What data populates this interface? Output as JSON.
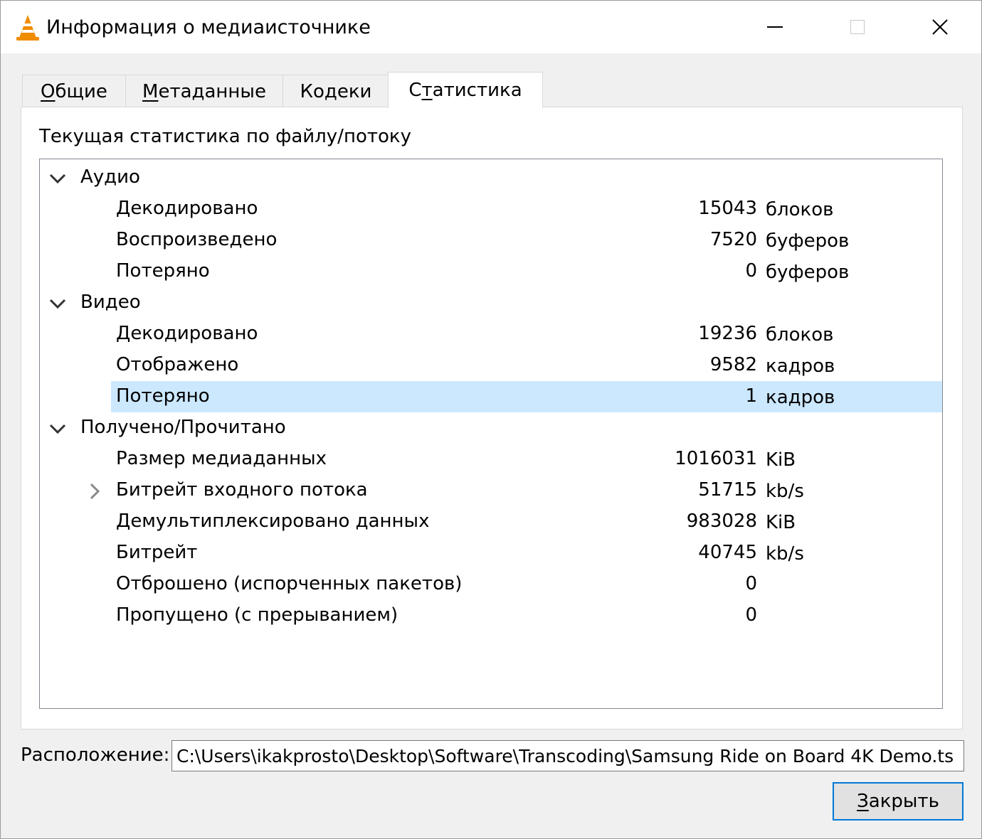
{
  "window": {
    "title": "Информация о медиаисточнике"
  },
  "tabs": [
    {
      "label_access": "О",
      "label_rest": "бщие"
    },
    {
      "label_access": "М",
      "label_rest": "етаданные"
    },
    {
      "label_pre": "",
      "label_access": "",
      "label_rest": "Кодеки"
    },
    {
      "label_pre": "С",
      "label_access": "т",
      "label_rest": "атистика"
    }
  ],
  "panel": {
    "heading": "Текущая статистика по файлу/потоку"
  },
  "tree": {
    "audio": {
      "title": "Аудио",
      "rows": [
        {
          "label": "Декодировано",
          "value": "15043",
          "unit": "блоков"
        },
        {
          "label": "Воспроизведено",
          "value": "7520",
          "unit": "буферов"
        },
        {
          "label": "Потеряно",
          "value": "0",
          "unit": "буферов"
        }
      ]
    },
    "video": {
      "title": "Видео",
      "rows": [
        {
          "label": "Декодировано",
          "value": "19236",
          "unit": "блоков"
        },
        {
          "label": "Отображено",
          "value": "9582",
          "unit": "кадров"
        },
        {
          "label": "Потеряно",
          "value": "1",
          "unit": "кадров"
        }
      ]
    },
    "input": {
      "title": "Получено/Прочитано",
      "rows": [
        {
          "label": "Размер медиаданных",
          "value": "1016031",
          "unit": "KiB"
        },
        {
          "label": "Битрейт входного потока",
          "value": "51715",
          "unit": "kb/s"
        },
        {
          "label": "Демультиплексировано данных",
          "value": "983028",
          "unit": "KiB"
        },
        {
          "label": "Битрейт",
          "value": "40745",
          "unit": "kb/s"
        },
        {
          "label": "Отброшено (испорченных пакетов)",
          "value": "0",
          "unit": ""
        },
        {
          "label": "Пропущено (с прерыванием)",
          "value": "0",
          "unit": ""
        }
      ]
    }
  },
  "location": {
    "label": "Расположение:",
    "value": "C:\\Users\\ikakprosto\\Desktop\\Software\\Transcoding\\Samsung Ride on Board 4K Demo.ts"
  },
  "close_button": {
    "access": "З",
    "rest": "акрыть"
  },
  "colors": {
    "selection": "#cce8ff",
    "accent": "#0078d7",
    "cone_orange": "#f08c00"
  }
}
